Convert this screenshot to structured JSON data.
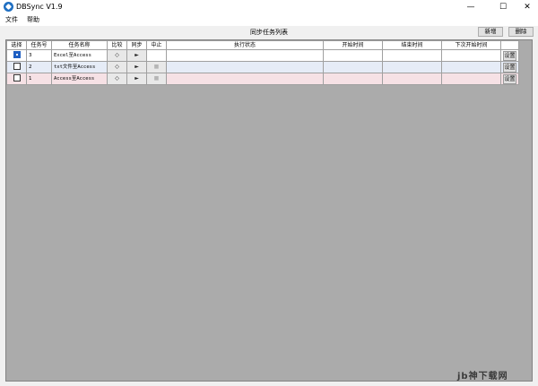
{
  "window": {
    "title": "DBSync V1.9",
    "min_glyph": "—",
    "max_glyph": "☐",
    "close_glyph": "✕"
  },
  "menu": {
    "items": [
      "文件",
      "帮助"
    ]
  },
  "toolbar": {
    "list_title": "同步任务列表",
    "new_label": "新增",
    "delete_label": "删除"
  },
  "grid": {
    "columns": [
      "选择",
      "任务号",
      "任务名称",
      "比较",
      "同步",
      "中止",
      "执行状态",
      "开始时间",
      "结束时间",
      "下次开始时间",
      ""
    ],
    "rows": [
      {
        "selected": true,
        "id": "3",
        "name": "Excel至Access",
        "compare": "◇",
        "sync": "►",
        "abort": "",
        "status": "",
        "start": "",
        "end": "",
        "next": "",
        "settings": "设置"
      },
      {
        "selected": false,
        "id": "2",
        "name": "txt文件至Access",
        "compare": "◇",
        "sync": "►",
        "abort": "■",
        "status": "",
        "start": "",
        "end": "",
        "next": "",
        "settings": "设置"
      },
      {
        "selected": false,
        "id": "1",
        "name": "Access至Access",
        "compare": "◇",
        "sync": "►",
        "abort": "■",
        "status": "",
        "start": "",
        "end": "",
        "next": "",
        "settings": "设置"
      }
    ]
  },
  "watermark": "jb神下载网",
  "colors": {
    "row_white": "#ffffff",
    "row_blue": "#e6ecf7",
    "row_pink": "#f6e1e5",
    "grid_background": "#ababab",
    "app_icon": "#1f6fc2"
  }
}
